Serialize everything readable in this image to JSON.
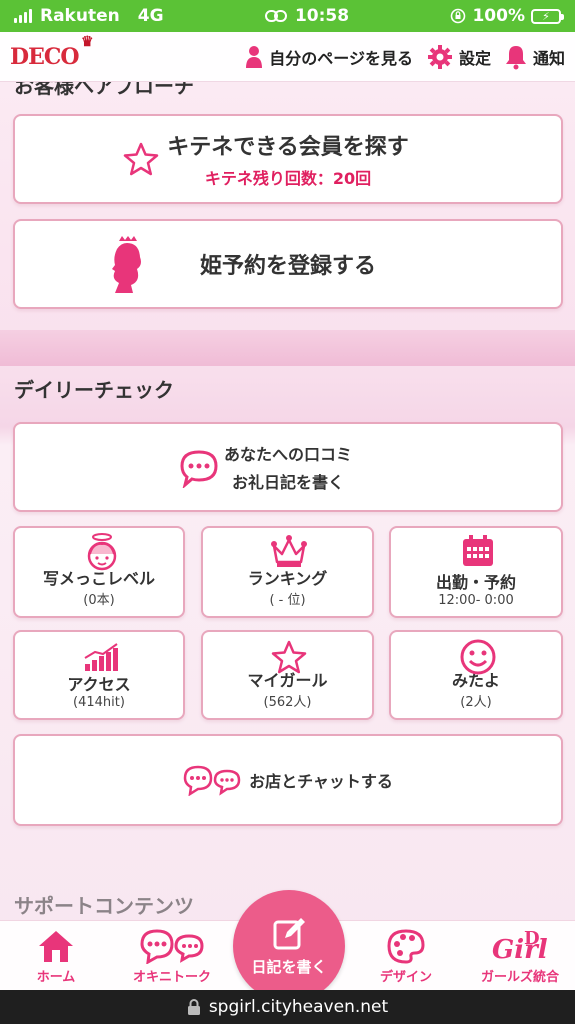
{
  "status_bar": {
    "carrier": "Rakuten",
    "network": "4G",
    "time": "10:58",
    "battery": "100%"
  },
  "header": {
    "logo": "DECO",
    "my_page": "自分のページを見る",
    "settings": "設定",
    "notifications": "通知"
  },
  "sections": {
    "approach_title": "お客様へアプローチ",
    "daily_title": "デイリーチェック",
    "support_title": "サポートコンテンツ"
  },
  "approach": {
    "kitene_label": "キテネできる会員を探す",
    "kitene_remaining": "キテネ残り回数：20回",
    "hime_label": "姫予約を登録する"
  },
  "daily": {
    "review_line1": "あなたへの口コミ",
    "review_line2": "お礼日記を書く",
    "tiles": [
      {
        "label": "写メっこレベル",
        "sub": "(0本)",
        "icon": "angel-girl-icon"
      },
      {
        "label": "ランキング",
        "sub": "( - 位)",
        "icon": "crown-icon"
      },
      {
        "label": "出勤・予約",
        "sub": "12:00- 0:00",
        "icon": "calendar-icon"
      },
      {
        "label": "アクセス",
        "sub": "(414hit)",
        "icon": "chart-icon"
      },
      {
        "label": "マイガール",
        "sub": "(562人)",
        "icon": "star-icon"
      },
      {
        "label": "みたよ",
        "sub": "(2人)",
        "icon": "smile-icon"
      }
    ],
    "chat_label": "お店とチャットする"
  },
  "bottom_nav": {
    "home": "ホーム",
    "okini": "オキニトーク",
    "diary": "日記を書く",
    "design": "デザイン",
    "girls": "ガールズ統合"
  },
  "url": "spgirl.cityheaven.net",
  "colors": {
    "status_green": "#5bc236",
    "accent_pink": "#e8357a",
    "card_border": "#e8a7bd"
  }
}
